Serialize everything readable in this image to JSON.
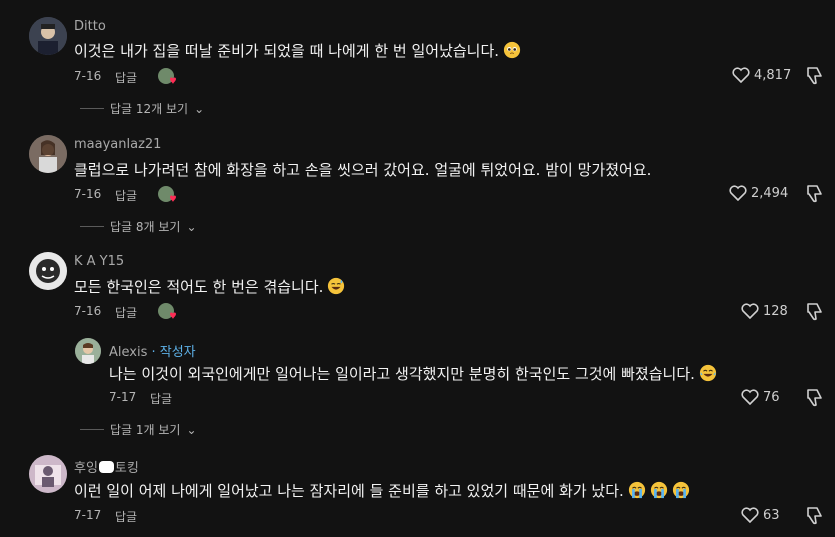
{
  "comments": [
    {
      "username": "Ditto",
      "text": "이것은 내가 집을 떠날 준비가 되었을 때 나에게 한 번 일어났습니다.",
      "emoji": "pleading-face",
      "date": "7-16",
      "reply_label": "답글",
      "likes": "4,817",
      "view_replies": "답글 12개 보기"
    },
    {
      "username": "maayanlaz21",
      "text": "클럽으로 나가려던 참에 화장을 하고 손을 씻으러 갔어요. 얼굴에 튀었어요. 밤이 망가졌어요.",
      "date": "7-16",
      "reply_label": "답글",
      "likes": "2,494",
      "view_replies": "답글 8개 보기"
    },
    {
      "username": "K A Y15",
      "text": "모든 한국인은 적어도 한 번은 겪습니다.",
      "emoji": "sweat-smile",
      "date": "7-16",
      "reply_label": "답글",
      "likes": "128"
    },
    {
      "username": "Alexis",
      "author_tag": " · 작성자",
      "text": "나는 이것이 외국인에게만 일어나는 일이라고 생각했지만 분명히 한국인도 그것에 빠졌습니다.",
      "emoji": "tears-of-joy",
      "date": "7-17",
      "reply_label": "답글",
      "likes": "76",
      "view_replies": "답글 1개 보기"
    },
    {
      "username_prefix": "후잉",
      "username_suffix": "토킹",
      "text": "이런 일이 어제 나에게 일어났고 나는 잠자리에 들 준비를 하고 있었기 때문에 화가 났다.",
      "emoji": "loudly-crying x3",
      "date": "7-17",
      "reply_label": "답글",
      "likes": "63"
    }
  ]
}
